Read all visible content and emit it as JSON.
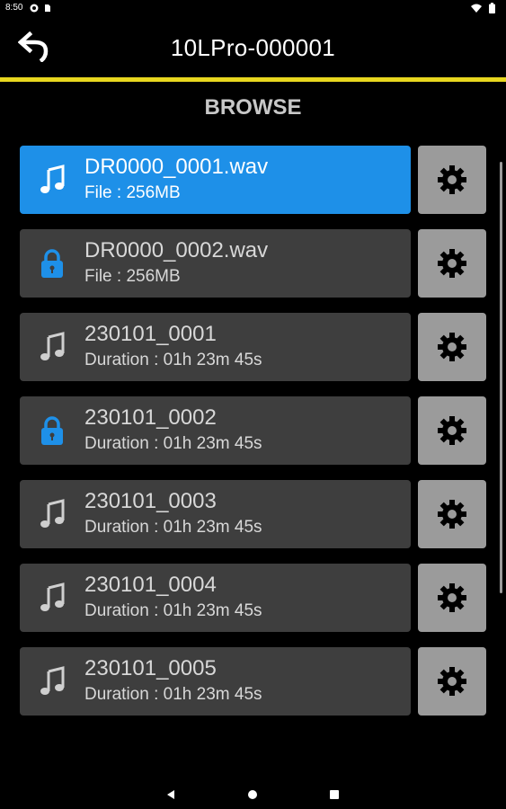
{
  "status": {
    "time": "8:50"
  },
  "header": {
    "title": "10LPro-000001"
  },
  "section": {
    "title": "BROWSE"
  },
  "items": [
    {
      "name": "DR0000_0001.wav",
      "sub": "File : 256MB",
      "icon": "music-note-icon",
      "selected": true
    },
    {
      "name": "DR0000_0002.wav",
      "sub": "File : 256MB",
      "icon": "lock-icon",
      "selected": false
    },
    {
      "name": "230101_0001",
      "sub": "Duration : 01h 23m 45s",
      "icon": "music-note-icon",
      "selected": false
    },
    {
      "name": "230101_0002",
      "sub": "Duration : 01h 23m 45s",
      "icon": "lock-icon",
      "selected": false
    },
    {
      "name": "230101_0003",
      "sub": "Duration : 01h 23m 45s",
      "icon": "music-note-icon",
      "selected": false
    },
    {
      "name": "230101_0004",
      "sub": "Duration : 01h 23m 45s",
      "icon": "music-note-icon",
      "selected": false
    },
    {
      "name": "230101_0005",
      "sub": "Duration : 01h 23m 45s",
      "icon": "music-note-icon",
      "selected": false
    }
  ],
  "colors": {
    "accent": "#1e90e8",
    "divider": "#e8d71f",
    "item_bg": "#3e3e3e",
    "gear_bg": "#9b9b9b"
  }
}
